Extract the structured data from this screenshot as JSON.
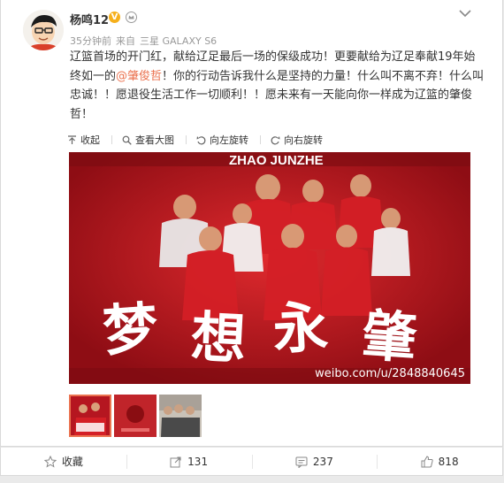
{
  "user": {
    "name": "杨鸣12",
    "verified_badge": "V"
  },
  "meta": {
    "time": "35分钟前",
    "source_prefix": "来自",
    "source": "三星 GALAXY S6"
  },
  "post": {
    "text_before": "辽篮首场的开门红，献给辽足最后一场的保级成功！更要献给为辽足奉献19年始终如一的",
    "mention": "@肇俊哲",
    "text_after": "！你的行动告诉我什么是坚持的力量！什么叫不离不弃！什么叫忠诚！！愿退役生活工作一切顺利！！愿未来有一天能向你一样成为辽篮的肇俊哲！"
  },
  "toolbar": {
    "collapse": "收起",
    "view_large": "查看大图",
    "rotate_left": "向左旋转",
    "rotate_right": "向右旋转"
  },
  "poster": {
    "title": "ZHAO JUNZHE",
    "watermark": "weibo.com/u/2848840645"
  },
  "actions": {
    "favorite": "收藏",
    "forward": "131",
    "comment": "237",
    "like": "818"
  },
  "colors": {
    "accent": "#eb7350",
    "poster_red": "#b51620",
    "badge": "#f6b01c"
  }
}
